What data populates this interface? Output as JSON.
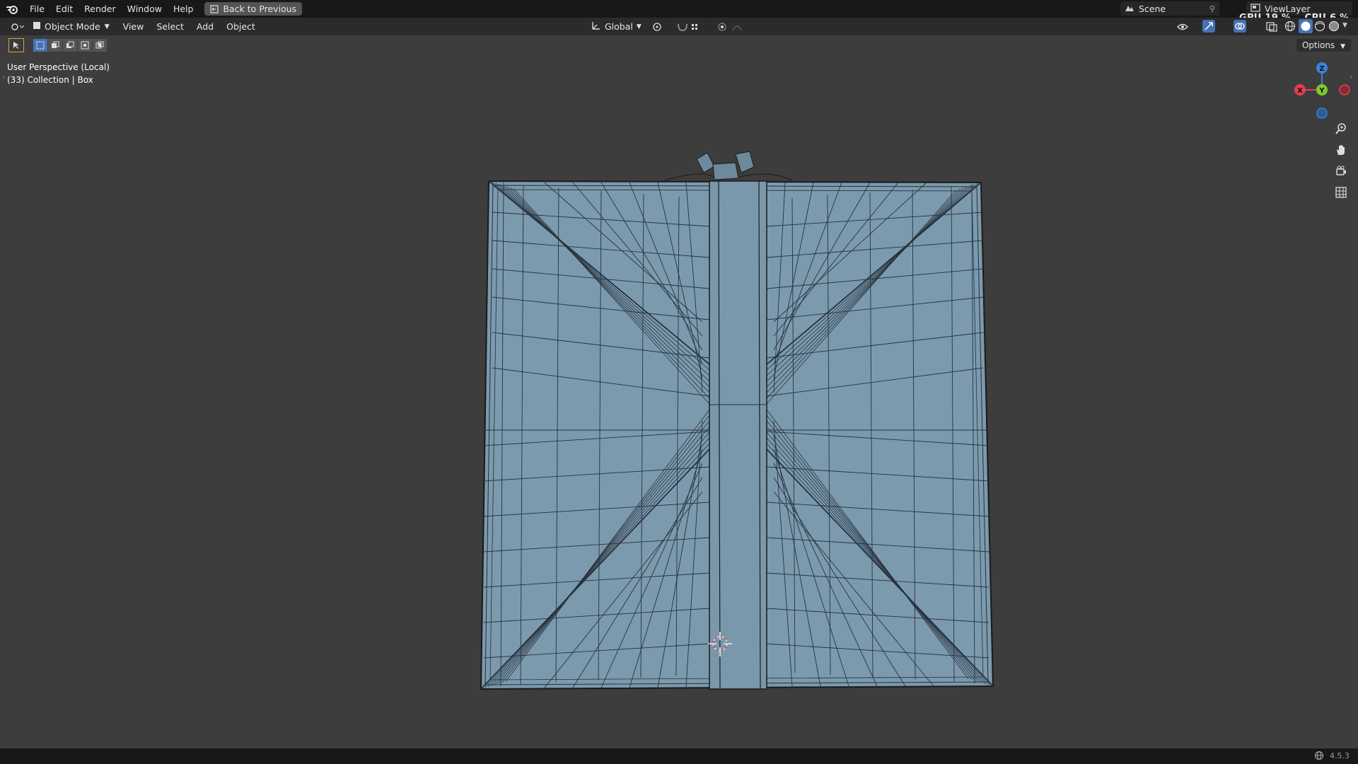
{
  "topbar": {
    "menus": [
      "File",
      "Edit",
      "Render",
      "Window",
      "Help"
    ],
    "back_label": "Back to Previous",
    "scene_label": "Scene",
    "viewlayer_label": "ViewLayer",
    "gpu_label": "GPU",
    "gpu_value": "19 %",
    "cpu_label": "CPU",
    "cpu_value": "6 %"
  },
  "header": {
    "mode_label": "Object Mode",
    "menus": [
      "View",
      "Select",
      "Add",
      "Object"
    ],
    "orientation_label": "Global",
    "options_label": "Options"
  },
  "viewport": {
    "perspective_label": "User Perspective (Local)",
    "collection_label": "(33) Collection | Box",
    "mesh_color": "#7c9aad",
    "axes": {
      "x": "X",
      "y": "Y",
      "z": "Z"
    }
  },
  "statusbar": {
    "version": "4.5.3"
  },
  "colors": {
    "background": "#3d3d3d",
    "topbar": "#181818",
    "header": "#2b2b2b",
    "axis_x": "#e2404e",
    "axis_y": "#7ecb2a",
    "axis_z": "#3b83d9"
  }
}
